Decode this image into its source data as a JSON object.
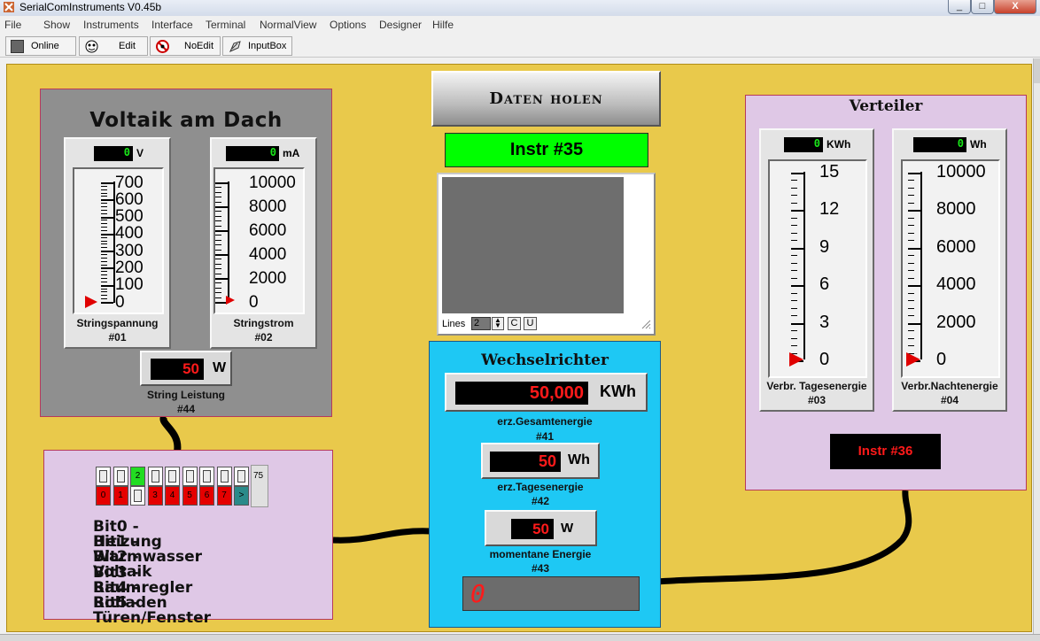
{
  "window": {
    "title": "SerialComInstruments  V0.45b",
    "controls": [
      "_",
      "□",
      "X"
    ]
  },
  "menu": [
    "File",
    "Show",
    "Instruments",
    "Interface",
    "Terminal",
    "NormalView",
    "Options",
    "Designer",
    "Hilfe"
  ],
  "toolbar": {
    "online": "Online",
    "edit": "Edit",
    "noedit": "NoEdit",
    "inputbox": "InputBox"
  },
  "voltaik": {
    "title": "Voltaik am Dach",
    "m1": {
      "value": "0",
      "unit": "V",
      "ticks": [
        "700",
        "600",
        "500",
        "400",
        "300",
        "200",
        "100",
        "0"
      ],
      "label": "Stringspannung",
      "num": "#01",
      "level": 0
    },
    "m2": {
      "value": "0",
      "unit": "mA",
      "ticks": [
        "10000",
        "8000",
        "6000",
        "4000",
        "2000",
        "0"
      ],
      "label": "Stringstrom",
      "num": "#02",
      "level": 0
    },
    "power": {
      "value": "50",
      "unit": "W",
      "label": "String Leistung",
      "num": "#44"
    }
  },
  "center": {
    "button": "Daten holen",
    "instr": "Instr #35",
    "terminal": {
      "lines_label": "Lines",
      "lines_value": "2",
      "c": "C",
      "u": "U"
    }
  },
  "wechsel": {
    "title": "Wechselrichter",
    "d1": {
      "value": "50,000",
      "unit": "KWh",
      "label": "erz.Gesamtenergie",
      "num": "#41"
    },
    "d2": {
      "value": "50",
      "unit": "Wh",
      "label": "erz.Tagesenergie",
      "num": "#42"
    },
    "d3": {
      "value": "50",
      "unit": "W",
      "label": "momentane Energie",
      "num": "#43"
    },
    "seg": "0"
  },
  "verteiler": {
    "title": "Verteiler",
    "m1": {
      "value": "0",
      "unit": "KWh",
      "ticks": [
        "15",
        "12",
        "9",
        "6",
        "3",
        "0"
      ],
      "label": "Verbr. Tagesenergie",
      "num": "#03",
      "level": 0
    },
    "m2": {
      "value": "0",
      "unit": "Wh",
      "ticks": [
        "10000",
        "8000",
        "6000",
        "4000",
        "2000",
        "0"
      ],
      "label": "Verbr.Nachtenergie",
      "num": "#04",
      "level": 0
    },
    "instr": "Instr #36"
  },
  "bits": {
    "switches": [
      {
        "label": "0",
        "on": false
      },
      {
        "label": "1",
        "on": false
      },
      {
        "label": "2",
        "on": true
      },
      {
        "label": "3",
        "on": false
      },
      {
        "label": "4",
        "on": false
      },
      {
        "label": "5",
        "on": false
      },
      {
        "label": "6",
        "on": false
      },
      {
        "label": "7",
        "on": false
      },
      {
        "label": ">",
        "on": false
      }
    ],
    "value": "75",
    "lines": [
      "Bit0 - Heizung",
      "Bit1 - Warmwasser",
      "Bit2 - Voltaik",
      "Bit3 - Raumregler",
      "Bit4 - Rolladen",
      "Bit5 - Türen/Fenster"
    ]
  },
  "colors": {
    "panel": "#e9c94b",
    "inverter": "#1ec8f4",
    "box": "#dfc8e6",
    "green": "#00ff00"
  }
}
